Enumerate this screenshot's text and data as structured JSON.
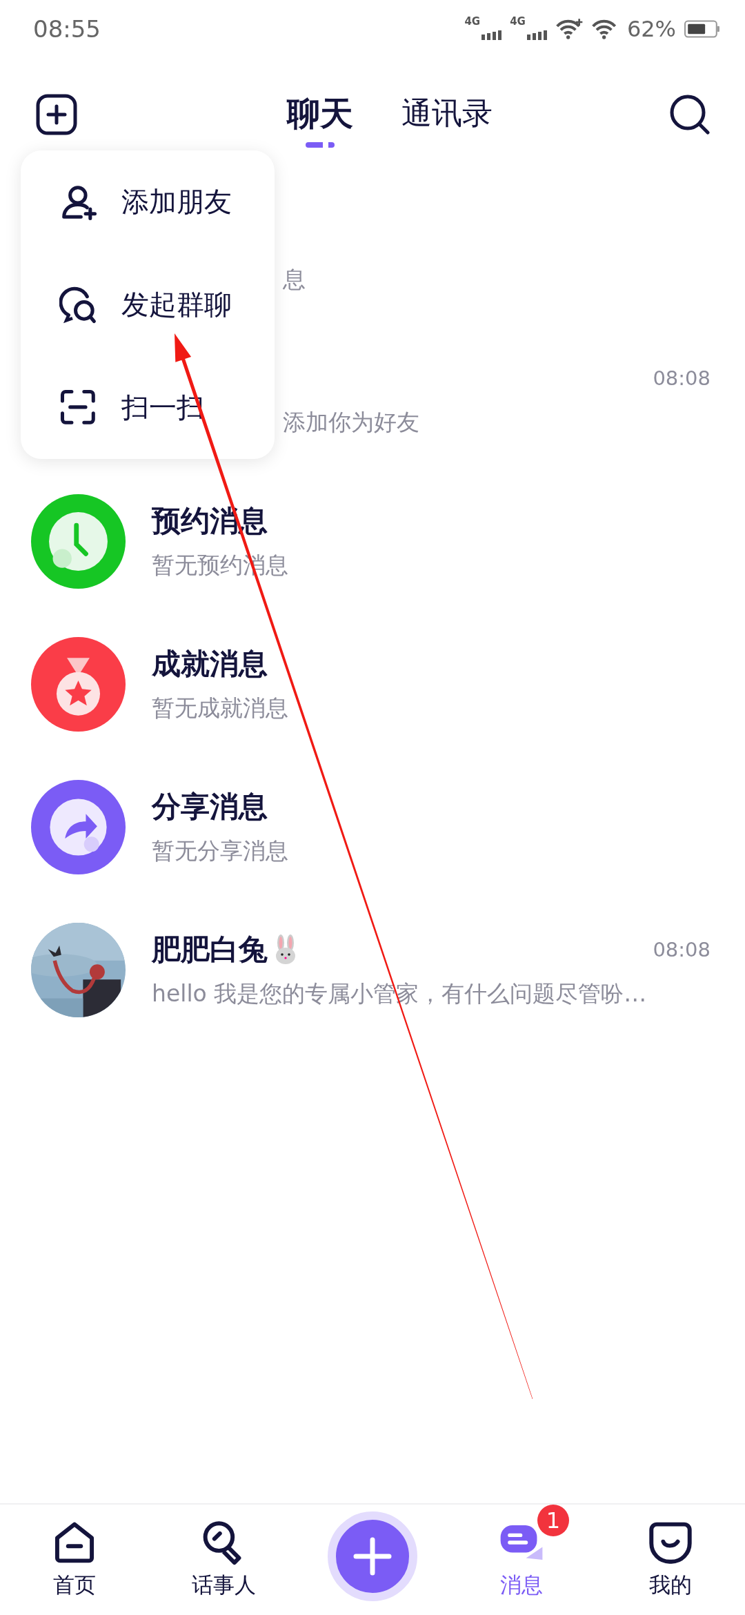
{
  "status_bar": {
    "time": "08:55",
    "networks": [
      "4G",
      "4G"
    ],
    "battery": "62%"
  },
  "header": {
    "tabs": [
      {
        "label": "聊天",
        "selected": true
      },
      {
        "label": "通讯录",
        "selected": false
      }
    ]
  },
  "menu": {
    "items": [
      {
        "kind": "add-friend",
        "label": "添加朋友"
      },
      {
        "kind": "group-chat",
        "label": "发起群聊"
      },
      {
        "kind": "scan",
        "label": "扫一扫"
      }
    ]
  },
  "conversations": [
    {
      "kind": "partial",
      "subtitle": "息"
    },
    {
      "kind": "partial",
      "time": "08:08",
      "subtitle": "添加你为好友"
    },
    {
      "kind": "schedule",
      "title": "预约消息",
      "subtitle": "暂无预约消息"
    },
    {
      "kind": "achievement",
      "title": "成就消息",
      "subtitle": "暂无成就消息"
    },
    {
      "kind": "share",
      "title": "分享消息",
      "subtitle": "暂无分享消息"
    },
    {
      "kind": "contact",
      "title": "肥肥白兔",
      "time": "08:08",
      "subtitle": "hello 我是您的专属小管家，有什么问题尽管吩…"
    }
  ],
  "bottom_nav": [
    {
      "kind": "home",
      "label": "首页",
      "selected": false
    },
    {
      "kind": "people",
      "label": "话事人",
      "selected": false
    },
    {
      "kind": "create",
      "selected": false
    },
    {
      "kind": "messages",
      "label": "消息",
      "selected": true,
      "badge": "1"
    },
    {
      "kind": "me",
      "label": "我的",
      "selected": false
    }
  ]
}
